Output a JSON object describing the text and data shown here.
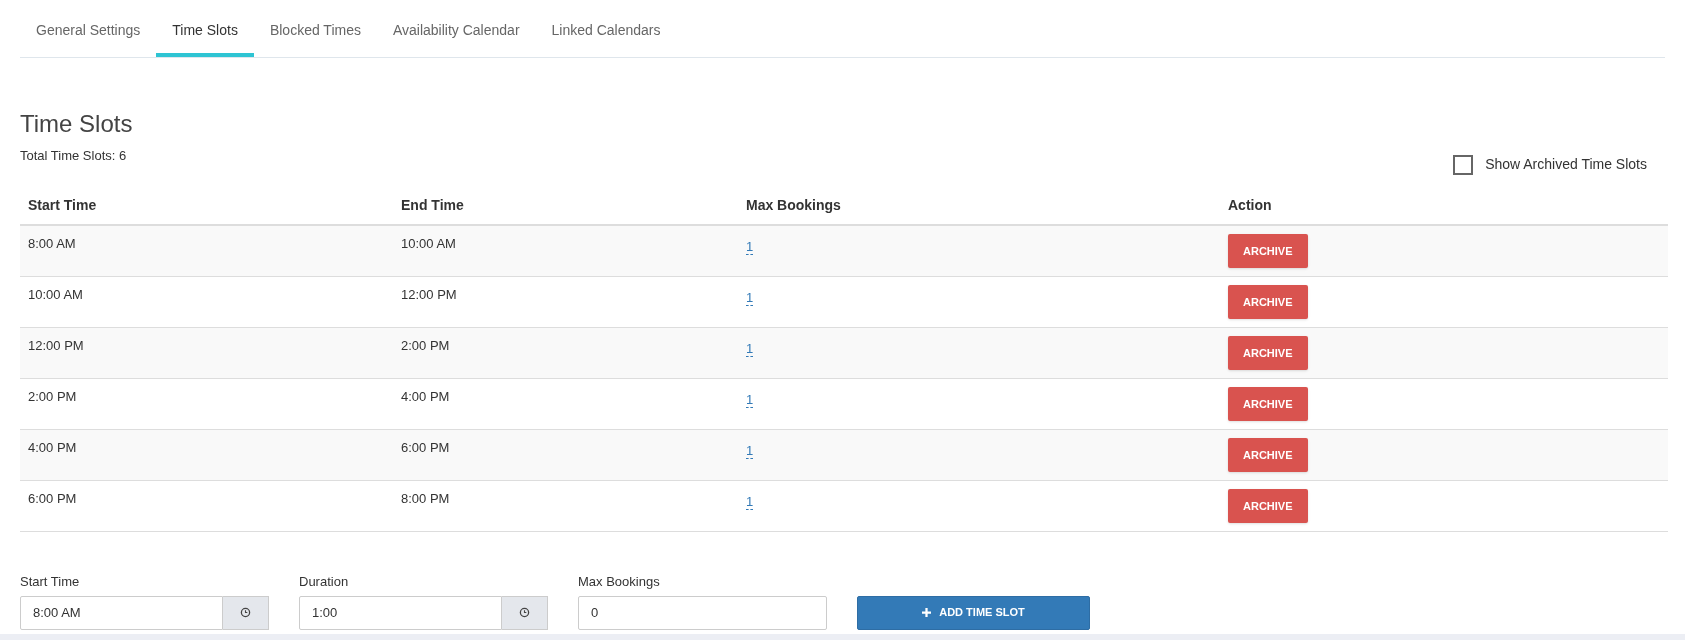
{
  "tabs": [
    {
      "label": "General Settings",
      "selected": false
    },
    {
      "label": "Time Slots",
      "selected": true
    },
    {
      "label": "Blocked Times",
      "selected": false
    },
    {
      "label": "Availability Calendar",
      "selected": false
    },
    {
      "label": "Linked Calendars",
      "selected": false
    }
  ],
  "title": "Time Slots",
  "total": "Total Time Slots: 6",
  "show_archived": {
    "label": "Show Archived Time Slots",
    "checked": false
  },
  "table": {
    "columns": [
      "Start Time",
      "End Time",
      "Max Bookings",
      "Action"
    ],
    "rows": [
      {
        "start": "8:00 AM",
        "end": "10:00 AM",
        "max": "1",
        "action": "ARCHIVE"
      },
      {
        "start": "10:00 AM",
        "end": "12:00 PM",
        "max": "1",
        "action": "ARCHIVE"
      },
      {
        "start": "12:00 PM",
        "end": "2:00 PM",
        "max": "1",
        "action": "ARCHIVE"
      },
      {
        "start": "2:00 PM",
        "end": "4:00 PM",
        "max": "1",
        "action": "ARCHIVE"
      },
      {
        "start": "4:00 PM",
        "end": "6:00 PM",
        "max": "1",
        "action": "ARCHIVE"
      },
      {
        "start": "6:00 PM",
        "end": "8:00 PM",
        "max": "1",
        "action": "ARCHIVE"
      }
    ]
  },
  "form": {
    "fields": [
      {
        "label": "Start Time",
        "value": "8:00 AM",
        "kind": "time"
      },
      {
        "label": "Duration",
        "value": "1:00",
        "kind": "time"
      },
      {
        "label": "Max Bookings",
        "value": "0",
        "kind": "text"
      }
    ],
    "button": "ADD TIME SLOT"
  }
}
